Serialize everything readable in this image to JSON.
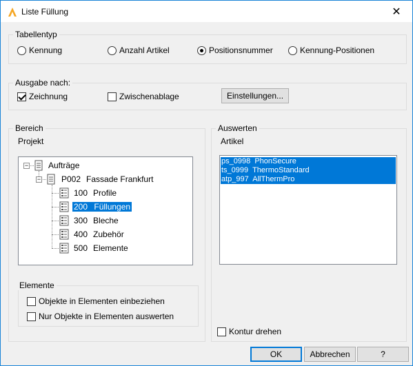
{
  "window": {
    "title": "Liste Füllung",
    "close": "✕"
  },
  "tabellentyp": {
    "label": "Tabellentyp",
    "options": [
      {
        "label": "Kennung",
        "selected": false
      },
      {
        "label": "Anzahl Artikel",
        "selected": false
      },
      {
        "label": "Positionsnummer",
        "selected": true
      },
      {
        "label": "Kennung-Positionen",
        "selected": false
      }
    ]
  },
  "ausgabe": {
    "label": "Ausgabe nach:",
    "zeichnung": {
      "label": "Zeichnung",
      "checked": true
    },
    "zwischenablage": {
      "label": "Zwischenablage",
      "checked": false
    },
    "einstellungen": "Einstellungen..."
  },
  "bereich": {
    "label": "Bereich",
    "projekt_label": "Projekt",
    "tree": {
      "root": "Aufträge",
      "project": {
        "code": "P002",
        "name": "Fassade Frankfurt"
      },
      "children": [
        {
          "code": "100",
          "name": "Profile",
          "selected": false
        },
        {
          "code": "200",
          "name": "Füllungen",
          "selected": true
        },
        {
          "code": "300",
          "name": "Bleche",
          "selected": false
        },
        {
          "code": "400",
          "name": "Zubehör",
          "selected": false
        },
        {
          "code": "500",
          "name": "Elemente",
          "selected": false
        }
      ]
    }
  },
  "elemente": {
    "label": "Elemente",
    "einbeziehen": {
      "label": "Objekte in Elementen einbeziehen",
      "checked": false
    },
    "nur_auswerten": {
      "label": "Nur Objekte in Elementen auswerten",
      "checked": false
    }
  },
  "auswerten": {
    "label": "Auswerten",
    "artikel_label": "Artikel",
    "items": [
      {
        "code": "ps_0998",
        "name": "PhonSecure"
      },
      {
        "code": "ts_0999",
        "name": "ThermoStandard"
      },
      {
        "code": "atp_997",
        "name": "AllThermPro"
      }
    ],
    "kontur": {
      "label": "Kontur drehen",
      "checked": false
    }
  },
  "footer": {
    "ok": "OK",
    "cancel": "Abbrechen",
    "help": "?"
  },
  "colors": {
    "selection": "#0078d7",
    "accent_border": "#1883d7"
  }
}
